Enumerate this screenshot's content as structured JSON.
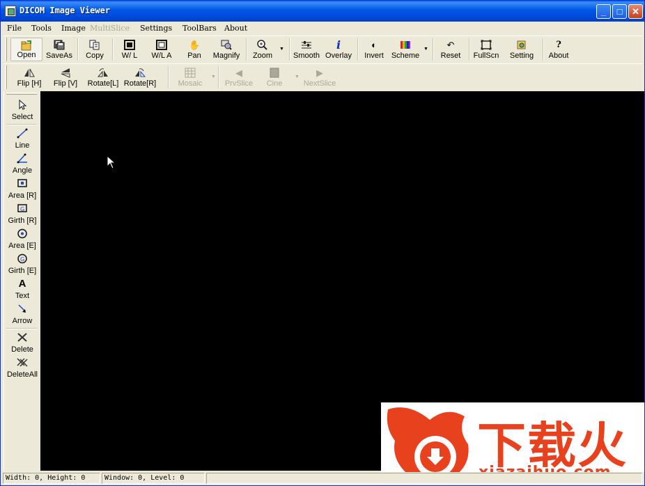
{
  "window": {
    "title": "DICOM Image Viewer",
    "min_glyph": "_",
    "max_glyph": "□",
    "close_glyph": "✕"
  },
  "menu": [
    {
      "label": "File",
      "enabled": true
    },
    {
      "label": "Tools",
      "enabled": true
    },
    {
      "label": "Image",
      "enabled": true
    },
    {
      "label": "MultiSlice",
      "enabled": false
    },
    {
      "label": "Settings",
      "enabled": true
    },
    {
      "label": "ToolBars",
      "enabled": true
    },
    {
      "label": "About",
      "enabled": true
    }
  ],
  "toolbar1": [
    {
      "label": "Open",
      "icon": "open-folder-icon"
    },
    {
      "label": "SaveAs",
      "icon": "save-as-icon"
    },
    {
      "label": "Copy",
      "icon": "copy-icon"
    },
    {
      "label": "W/ L",
      "icon": "window-level-icon"
    },
    {
      "label": "W/L A",
      "icon": "window-level-auto-icon"
    },
    {
      "label": "Pan",
      "icon": "hand-icon"
    },
    {
      "label": "Magnify",
      "icon": "magnify-icon"
    },
    {
      "label": "Zoom",
      "icon": "zoom-icon"
    },
    {
      "label": "Smooth",
      "icon": "smooth-icon"
    },
    {
      "label": "Overlay",
      "icon": "info-icon"
    },
    {
      "label": "Invert",
      "icon": "invert-icon"
    },
    {
      "label": "Scheme",
      "icon": "color-scheme-icon"
    },
    {
      "label": "Reset",
      "icon": "reset-icon"
    },
    {
      "label": "FullScn",
      "icon": "fullscreen-icon"
    },
    {
      "label": "Setting",
      "icon": "setting-icon"
    },
    {
      "label": "About",
      "icon": "help-icon"
    }
  ],
  "toolbar2": [
    {
      "label": "Flip [H]",
      "icon": "flip-horizontal-icon"
    },
    {
      "label": "Flip [V]",
      "icon": "flip-vertical-icon"
    },
    {
      "label": "Rotate[L]",
      "icon": "rotate-left-icon"
    },
    {
      "label": "Rotate[R]",
      "icon": "rotate-right-icon"
    },
    {
      "label": "Mosaic",
      "icon": "mosaic-icon"
    },
    {
      "label": "PrvSlice",
      "icon": "previous-slice-icon"
    },
    {
      "label": "Cine",
      "icon": "cine-icon"
    },
    {
      "label": "NextSlice",
      "icon": "next-slice-icon"
    }
  ],
  "left_tools": [
    {
      "label": "Select",
      "icon": "arrow-cursor-icon"
    },
    {
      "label": "Line",
      "icon": "line-icon"
    },
    {
      "label": "Angle",
      "icon": "angle-icon"
    },
    {
      "label": "Area [R]",
      "icon": "area-rectangle-icon"
    },
    {
      "label": "Girth [R]",
      "icon": "girth-rectangle-icon"
    },
    {
      "label": "Area [E]",
      "icon": "area-ellipse-icon"
    },
    {
      "label": "Girth [E]",
      "icon": "girth-ellipse-icon"
    },
    {
      "label": "Text",
      "icon": "text-icon"
    },
    {
      "label": "Arrow",
      "icon": "arrow-annotation-icon"
    },
    {
      "label": "Delete",
      "icon": "delete-icon"
    },
    {
      "label": "DeleteAll",
      "icon": "delete-all-icon"
    }
  ],
  "status": {
    "dimensions": "Width: 0, Height: 0",
    "window_level": "Window: 0, Level: 0",
    "extra": ""
  },
  "watermark": {
    "brand": "下载火",
    "url": "xiazaihuo.com"
  },
  "colors": {
    "title_bar": "#0058E6",
    "viewer_bg": "#000000",
    "watermark": "#E8411E",
    "chrome": "#ECE9D8"
  }
}
